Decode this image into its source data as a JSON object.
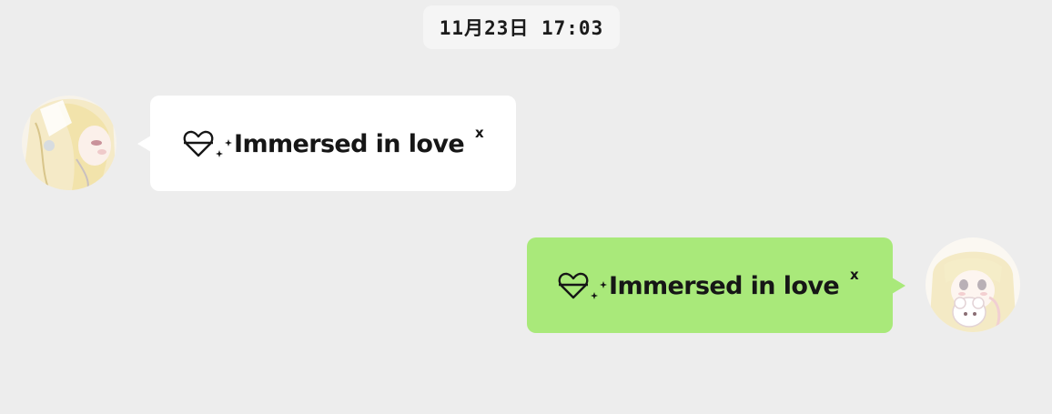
{
  "chat": {
    "timestamp": "11月23日 17:03",
    "messages": [
      {
        "direction": "incoming",
        "text": "Immersed in love",
        "suffix": "x",
        "icon": "heart-sparkle-icon",
        "bubble_color": "#ffffff"
      },
      {
        "direction": "outgoing",
        "text": "Immersed in love",
        "suffix": "x",
        "icon": "heart-sparkle-icon",
        "bubble_color": "#a9e97a"
      }
    ]
  },
  "colors": {
    "background": "#ededed",
    "incoming_bubble": "#ffffff",
    "outgoing_bubble": "#a9e97a",
    "timestamp_bg": "#f5f5f5"
  }
}
